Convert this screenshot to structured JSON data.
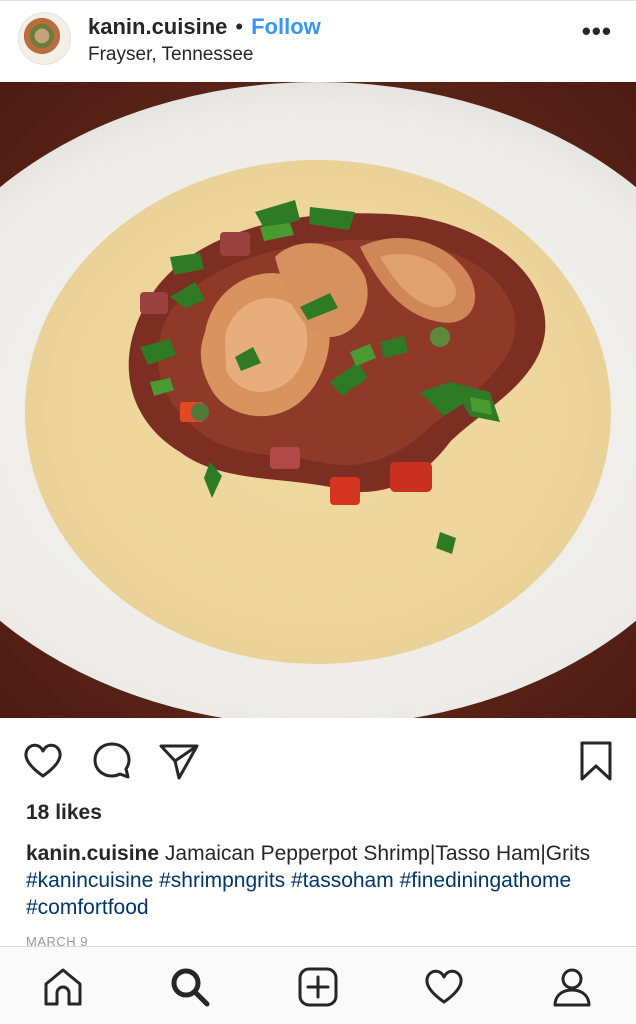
{
  "post": {
    "username": "kanin.cuisine",
    "separator": "•",
    "follow_label": "Follow",
    "location": "Frayser, Tennessee",
    "more_label": "•••",
    "likes": "18 likes",
    "caption_text": "Jamaican Pepperpot Shrimp|Tasso Ham|Grits",
    "hashtags": [
      "#kanincuisine",
      "#shrimpngrits",
      "#tassoham",
      "#finediningathome",
      "#comfortfood"
    ],
    "date": "MARCH 9"
  },
  "icons": {
    "actions": [
      "heart-icon",
      "comment-icon",
      "share-icon",
      "bookmark-icon"
    ],
    "nav": [
      "home-icon",
      "search-icon",
      "add-post-icon",
      "activity-icon",
      "profile-icon"
    ]
  },
  "colors": {
    "link": "#3897f0",
    "hashtag": "#003569",
    "text": "#262626"
  }
}
